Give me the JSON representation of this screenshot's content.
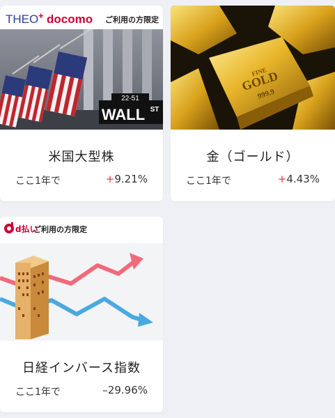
{
  "colors": {
    "background": "#eef0f5",
    "card": "#ffffff",
    "positive": "#e5344a",
    "negative": "#333333",
    "docomo_red": "#cc0033",
    "theo_blue": "#2a3f9e"
  },
  "cards": [
    {
      "title": "米国大型株",
      "period": "ここ1年で",
      "change_sign": "+",
      "change_value": "9.21%",
      "banner": {
        "brand1": "THEO",
        "brand1_plus": "+",
        "brand2": "docomo",
        "notice": "ご利用の方限定"
      },
      "image": {
        "icon": "wall-street-flags-image",
        "sign_number": "22-51",
        "sign_text": "WALL",
        "sign_suffix": "ST"
      }
    },
    {
      "title": "金（ゴールド）",
      "period": "ここ1年で",
      "change_sign": "+",
      "change_value": "4.43%",
      "image": {
        "icon": "gold-bars-image",
        "bar_text_top": "FINE",
        "bar_text": "GOLD",
        "bar_number": "999.9"
      }
    },
    {
      "title": "日経インバース指数",
      "period": "ここ1年で",
      "change_sign": "–",
      "change_value": "29.96%",
      "banner": {
        "brand": "d払い",
        "notice": "ご利用の方限定"
      },
      "image": {
        "icon": "inverse-chart-building-image"
      }
    }
  ]
}
